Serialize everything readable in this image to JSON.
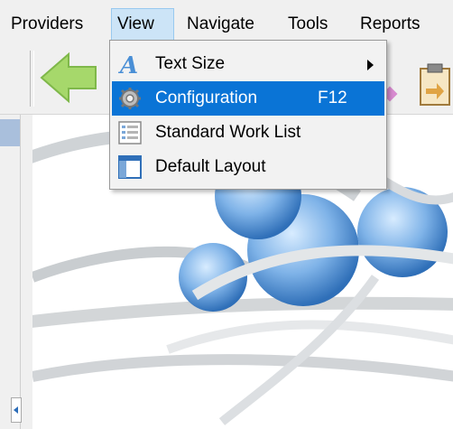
{
  "menubar": {
    "items": [
      {
        "label": "Providers"
      },
      {
        "label": "View"
      },
      {
        "label": "Navigate"
      },
      {
        "label": "Tools"
      },
      {
        "label": "Reports"
      }
    ]
  },
  "view_menu": {
    "items": [
      {
        "label": "Text Size",
        "icon": "text-size-icon",
        "has_submenu": true
      },
      {
        "label": "Configuration",
        "shortcut": "F12",
        "icon": "gear-icon",
        "highlighted": true
      },
      {
        "label": "Standard Work List",
        "icon": "list-icon"
      },
      {
        "label": "Default Layout",
        "icon": "layout-icon"
      }
    ]
  },
  "colors": {
    "menu_highlight": "#0a74d6",
    "menubar_active": "#cce4f7",
    "back_arrow": "#a6d86b",
    "background_art": "#6fa5dc"
  }
}
